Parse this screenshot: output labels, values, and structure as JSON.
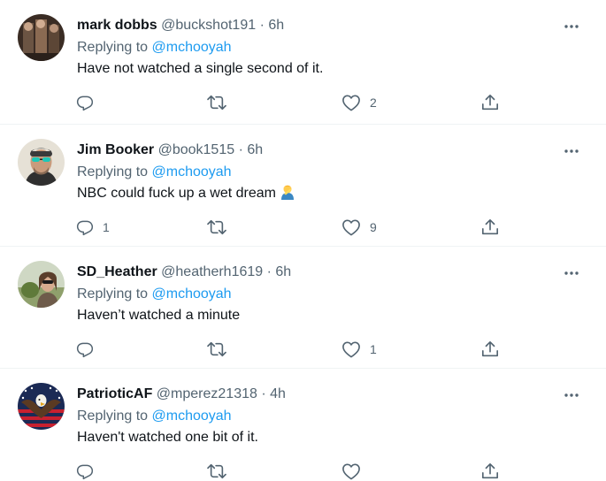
{
  "tweets": [
    {
      "name": "mark dobbs",
      "handle": "@buckshot191",
      "dot": "·",
      "time": "6h",
      "replying_label": "Replying to",
      "replying_to": "@mchooyah",
      "text": "Have not watched a single second of it.",
      "reply_count": "",
      "retweet_count": "",
      "like_count": "2"
    },
    {
      "name": "Jim Booker",
      "handle": "@book1515",
      "dot": "·",
      "time": "6h",
      "replying_label": "Replying to",
      "replying_to": "@mchooyah",
      "text": "NBC could fuck up a wet dream",
      "reply_count": "1",
      "retweet_count": "",
      "like_count": "9"
    },
    {
      "name": "SD_Heather",
      "handle": "@heatherh1619",
      "dot": "·",
      "time": "6h",
      "replying_label": "Replying to",
      "replying_to": "@mchooyah",
      "text": "Haven’t watched a minute",
      "reply_count": "",
      "retweet_count": "",
      "like_count": "1"
    },
    {
      "name": "PatrioticAF",
      "handle": "@mperez21318",
      "dot": "·",
      "time": "4h",
      "replying_label": "Replying to",
      "replying_to": "@mchooyah",
      "text": "Haven't watched one bit of it.",
      "reply_count": "",
      "retweet_count": "",
      "like_count": ""
    }
  ],
  "icons": {
    "more": "more-horizontal-icon",
    "reply": "reply-icon",
    "retweet": "retweet-icon",
    "like": "heart-icon",
    "share": "share-icon",
    "emoji": "person-facepalming-emoji"
  },
  "colors": {
    "text": "#0f1419",
    "secondary": "#536471",
    "link": "#1d9bf0",
    "divider": "#eff3f4"
  }
}
